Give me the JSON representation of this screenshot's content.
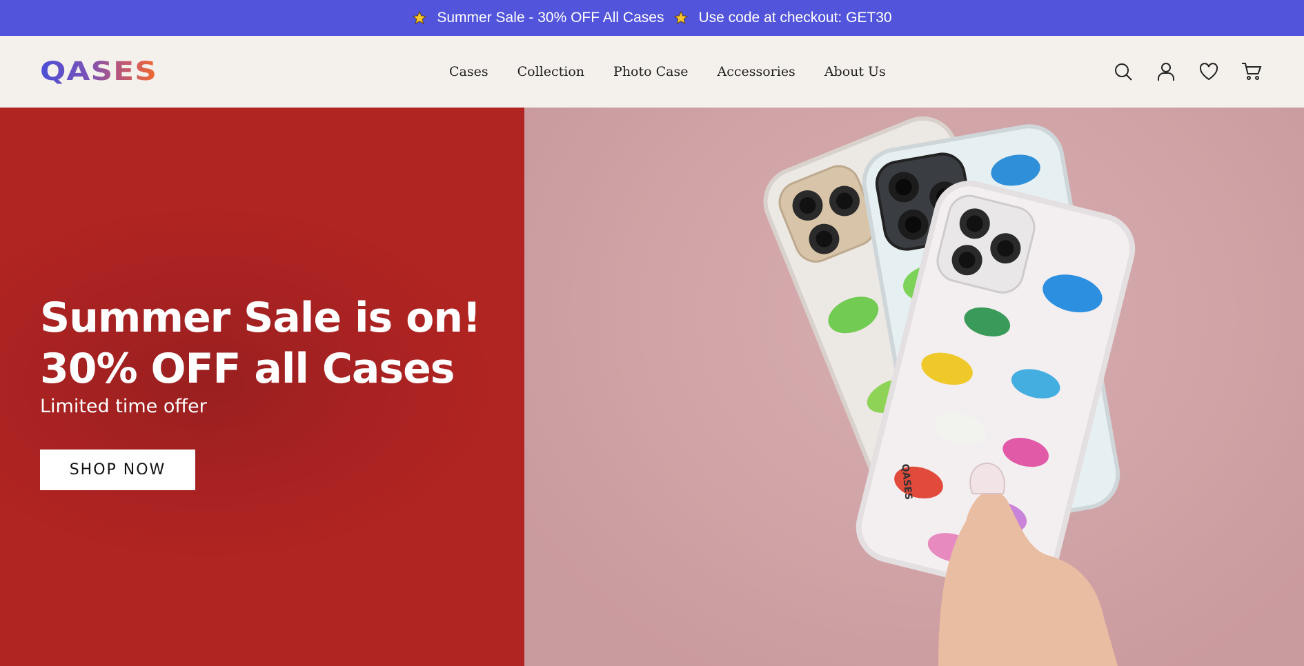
{
  "announcement": {
    "items": [
      "Summer Sale - 30% OFF All Cases",
      "Use code at checkout: GET30"
    ],
    "icon": "star-icon",
    "bg_color": "#5254db"
  },
  "header": {
    "logo": "QASES",
    "nav": [
      "Cases",
      "Collection",
      "Photo Case",
      "Accessories",
      "About Us"
    ],
    "icons": [
      "search-icon",
      "account-icon",
      "wishlist-heart-icon",
      "cart-icon"
    ]
  },
  "hero": {
    "headline_line1": "Summer Sale is on!",
    "headline_line2": "30% OFF all Cases",
    "subheadline": "Limited time offer",
    "cta_label": "SHOP NOW",
    "left_bg_color": "#b02421",
    "right_bg_color": "#d0a3a6",
    "image_logo_text": "QASES"
  }
}
